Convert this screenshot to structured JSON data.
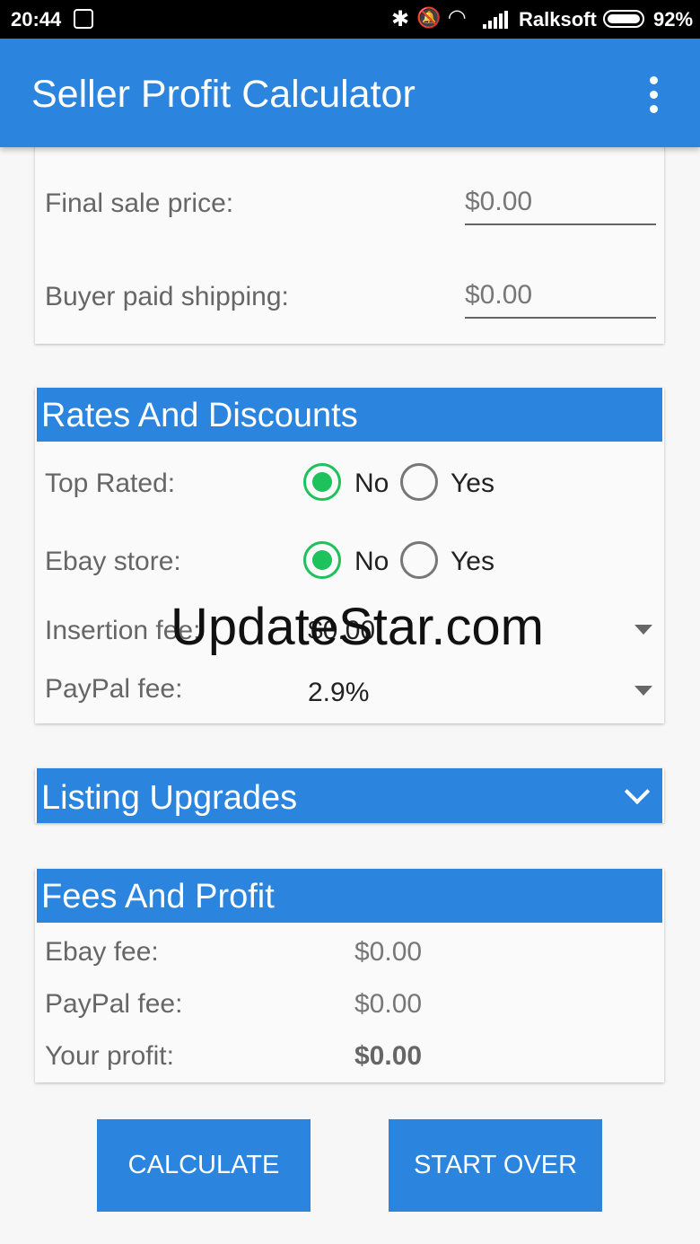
{
  "status_bar": {
    "time": "20:44",
    "carrier": "Ralksoft",
    "battery": "92%"
  },
  "app_bar": {
    "title": "Seller Profit Calculator",
    "menu_icon": "more-vert-icon"
  },
  "price_card": {
    "final_sale_label": "Final sale price:",
    "final_sale_value": "$0.00",
    "shipping_label": "Buyer paid shipping:",
    "shipping_value": "$0.00"
  },
  "rates_card": {
    "title": "Rates And Discounts",
    "top_rated_label": "Top Rated:",
    "ebay_store_label": "Ebay store:",
    "no_label": "No",
    "yes_label": "Yes",
    "insertion_label": "Insertion fee:",
    "insertion_value": "$0.00",
    "paypal_label": "PayPal fee:",
    "paypal_value": "2.9%"
  },
  "listing_card": {
    "title": "Listing Upgrades"
  },
  "fees_card": {
    "title": "Fees And Profit",
    "ebay_fee_label": "Ebay fee:",
    "ebay_fee_value": "$0.00",
    "paypal_fee_label": "PayPal fee:",
    "paypal_fee_value": "$0.00",
    "profit_label": "Your profit:",
    "profit_value": "$0.00"
  },
  "buttons": {
    "calculate": "CALCULATE",
    "start_over": "START OVER"
  },
  "watermark": "UpdateStar.com",
  "colors": {
    "primary": "#2b85df",
    "radio_selected": "#1ec25c"
  }
}
